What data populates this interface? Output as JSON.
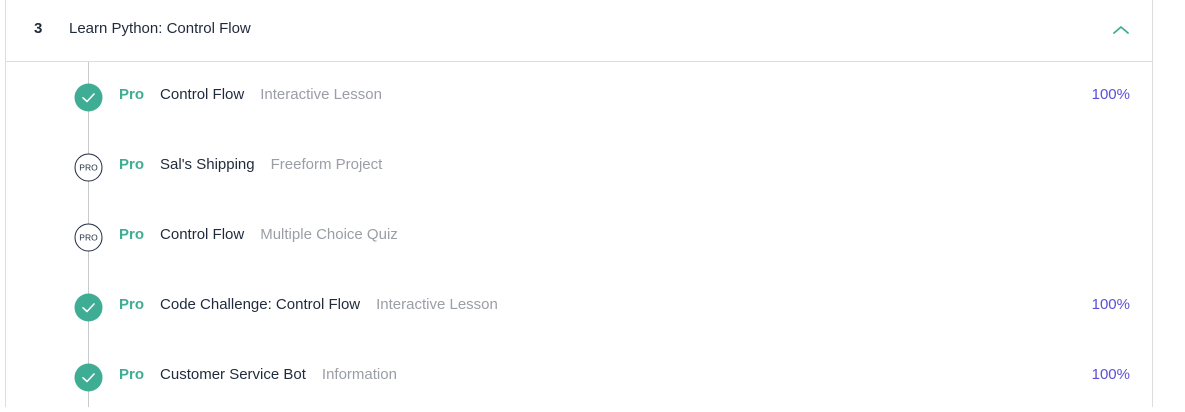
{
  "module": {
    "number": "3",
    "title": "Learn Python: Control Flow",
    "collapse_icon": "chevron-up-icon"
  },
  "colors": {
    "accent_green": "#3fad93",
    "progress_purple": "#5b4fd6",
    "text_dark": "#1f2a3c",
    "text_muted": "#9a9ea5"
  },
  "items": [
    {
      "pro": "Pro",
      "title": "Control Flow",
      "type": "Interactive Lesson",
      "progress": "100%",
      "status": "completed",
      "status_icon": "check-circle-icon"
    },
    {
      "pro": "Pro",
      "title": "Sal's Shipping",
      "type": "Freeform Project",
      "progress": "",
      "status": "pro-locked",
      "status_icon": "pro-badge-icon",
      "badge_text": "PRO"
    },
    {
      "pro": "Pro",
      "title": "Control Flow",
      "type": "Multiple Choice Quiz",
      "progress": "",
      "status": "pro-locked",
      "status_icon": "pro-badge-icon",
      "badge_text": "PRO"
    },
    {
      "pro": "Pro",
      "title": "Code Challenge: Control Flow",
      "type": "Interactive Lesson",
      "progress": "100%",
      "status": "completed",
      "status_icon": "check-circle-icon"
    },
    {
      "pro": "Pro",
      "title": "Customer Service Bot",
      "type": "Information",
      "progress": "100%",
      "status": "completed",
      "status_icon": "check-circle-icon"
    }
  ]
}
